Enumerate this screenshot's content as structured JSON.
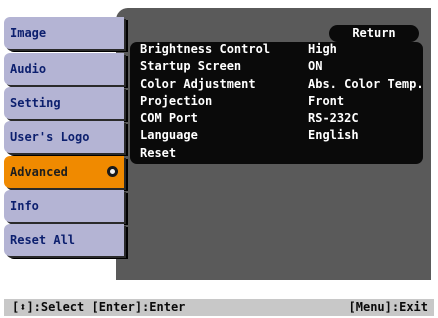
{
  "tabs": [
    {
      "label": "Image",
      "active": false
    },
    {
      "label": "Audio",
      "active": false
    },
    {
      "label": "Setting",
      "active": false
    },
    {
      "label": "User's Logo",
      "active": false
    },
    {
      "label": "Advanced",
      "active": true
    },
    {
      "label": "Info",
      "active": false
    },
    {
      "label": "Reset All",
      "active": false
    }
  ],
  "return_label": "Return",
  "settings": [
    {
      "label": "Brightness Control",
      "value": "High"
    },
    {
      "label": "Startup Screen",
      "value": "ON"
    },
    {
      "label": "Color Adjustment",
      "value": "Abs. Color Temp."
    },
    {
      "label": "Projection",
      "value": "Front"
    },
    {
      "label": "COM Port",
      "value": "RS-232C"
    },
    {
      "label": "Language",
      "value": "English"
    },
    {
      "label": "Reset",
      "value": ""
    }
  ],
  "footer": {
    "left": "[⬍]:Select [Enter]:Enter",
    "right": "[Menu]:Exit"
  },
  "colors": {
    "tab_bg": "#b4b4d4",
    "tab_active_bg": "#f08a00",
    "panel_bg": "#5a5a5a",
    "box_bg": "#0a0a0a"
  }
}
